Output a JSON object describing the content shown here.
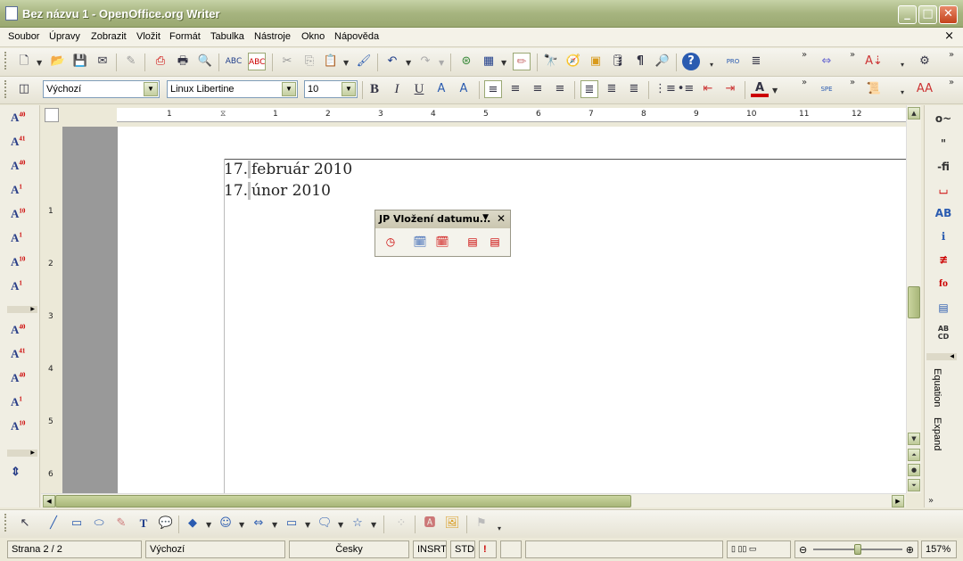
{
  "window": {
    "title": "Bez názvu 1 - OpenOffice.org Writer",
    "minimize": "_",
    "maximize": "□",
    "close": "✕"
  },
  "menubar": {
    "items": [
      "Soubor",
      "Úpravy",
      "Zobrazit",
      "Vložit",
      "Formát",
      "Tabulka",
      "Nástroje",
      "Okno",
      "Nápověda"
    ],
    "doc_close": "×"
  },
  "format_bar": {
    "paragraph_style": "Výchozí",
    "font_name": "Linux Libertine",
    "font_size": "10"
  },
  "ruler": {
    "h_labels": [
      "1",
      "1",
      "2",
      "3",
      "4",
      "5",
      "6",
      "7",
      "8",
      "9",
      "10",
      "11",
      "12"
    ],
    "v_labels": [
      "1",
      "2",
      "3",
      "4",
      "5",
      "6"
    ]
  },
  "document": {
    "lines": [
      {
        "num": "17.",
        "text": "február 2010"
      },
      {
        "num": "17.",
        "text": "únor 2010"
      }
    ]
  },
  "floating_toolbar": {
    "title": "JP Vložení datumu...",
    "close": "✕"
  },
  "right_bar": {
    "equation_label": "Equation",
    "expand_label": "Expand"
  },
  "statusbar": {
    "page": "Strana 2 / 2",
    "style": "Výchozí",
    "language": "Česky",
    "insert_mode": "INSRT",
    "selection_mode": "STD",
    "zoom": "157%"
  },
  "colors": {
    "titlebar": "#a6b47f",
    "page": "#ffffff",
    "page_margin": "#999999",
    "font_color_accent": "#cc0000"
  }
}
